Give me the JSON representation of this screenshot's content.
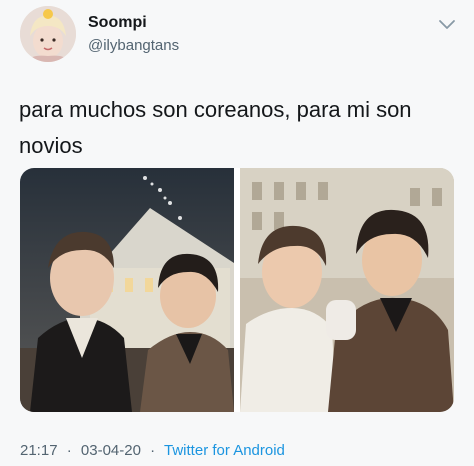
{
  "tweet": {
    "author": {
      "display_name": "Soompi",
      "handle": "@ilybangtans",
      "avatar_icon": "avatar-photo"
    },
    "menu_icon": "chevron-down-icon",
    "text": "para muchos son coreanos, para mi son novios",
    "media": {
      "count": 2,
      "photos": [
        {
          "icon": "photo-two-men-night-street"
        },
        {
          "icon": "photo-two-men-embracing"
        }
      ]
    },
    "meta": {
      "time": "21:17",
      "separator_1": "·",
      "date": "03-04-20",
      "separator_2": "·",
      "source": "Twitter for Android"
    },
    "colors": {
      "text": "#14171a",
      "secondary": "#536471",
      "link": "#1b95e0",
      "background": "#f7f8f9"
    }
  }
}
